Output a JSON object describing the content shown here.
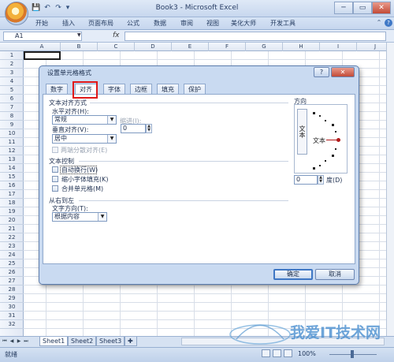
{
  "window": {
    "title": "Book3 - Microsoft Excel",
    "min": "─",
    "max": "▭",
    "close": "✕"
  },
  "quick_access": [
    "💾",
    "↶",
    "↷",
    "▾"
  ],
  "ribbon": {
    "tabs": [
      "开始",
      "插入",
      "页面布局",
      "公式",
      "数据",
      "审阅",
      "视图",
      "美化大师",
      "开发工具"
    ]
  },
  "formula_bar": {
    "name_box": "A1",
    "fx": "fx"
  },
  "grid": {
    "columns": [
      "A",
      "B",
      "C",
      "D",
      "E",
      "F",
      "G",
      "H",
      "I",
      "J"
    ],
    "rows": [
      "1",
      "2",
      "3",
      "4",
      "5",
      "6",
      "7",
      "8",
      "9",
      "10",
      "11",
      "12",
      "13",
      "14",
      "15",
      "16",
      "17",
      "18",
      "19",
      "20",
      "21",
      "22",
      "23",
      "24",
      "25",
      "26",
      "27",
      "28",
      "29",
      "30",
      "31",
      "32"
    ]
  },
  "sheets": [
    "Sheet1",
    "Sheet2",
    "Sheet3"
  ],
  "status": {
    "ready": "就绪",
    "zoom": "100%"
  },
  "dialog": {
    "title": "设置单元格格式",
    "help": "?",
    "close": "✕",
    "tabs": [
      "数字",
      "对齐",
      "字体",
      "边框",
      "填充",
      "保护"
    ],
    "text_alignment": {
      "heading": "文本对齐方式",
      "horizontal_label": "水平对齐(H):",
      "horizontal_value": "常规",
      "indent_label": "缩进(I):",
      "indent_value": "0",
      "vertical_label": "垂直对齐(V):",
      "vertical_value": "居中",
      "justify_distributed": "两端分散对齐(E)"
    },
    "text_control": {
      "heading": "文本控制",
      "wrap": "自动换行(W)",
      "shrink": "缩小字体填充(K)",
      "merge": "合并单元格(M)"
    },
    "rtl": {
      "heading": "从右到左",
      "direction_label": "文字方向(T):",
      "direction_value": "根据内容"
    },
    "orientation": {
      "heading": "方向",
      "vertical_text": "文本",
      "horizontal_text": "文本",
      "degrees_value": "0",
      "degrees_label": "度(D)"
    },
    "ok": "确定",
    "cancel": "取消"
  },
  "watermark": {
    "text": "我爱IT技术网"
  }
}
